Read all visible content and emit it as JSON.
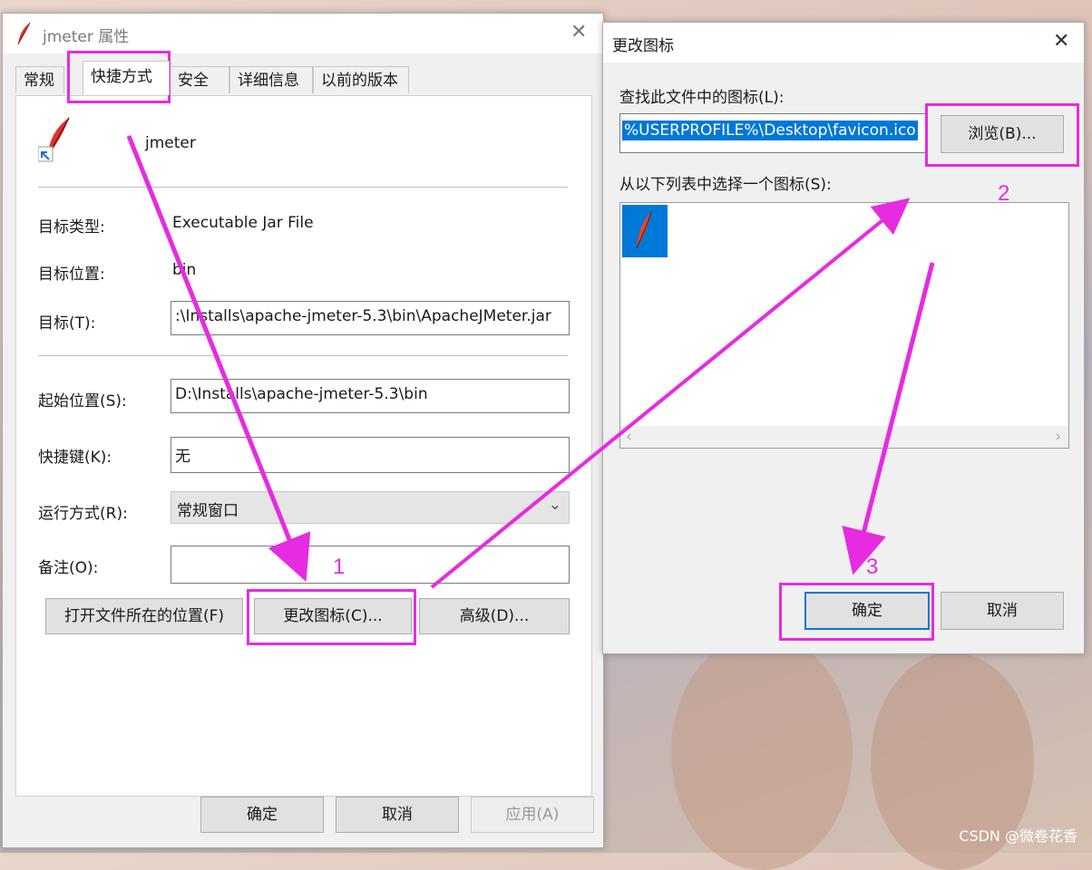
{
  "props_dialog": {
    "title": "jmeter 属性",
    "tabs": [
      {
        "label": "常规"
      },
      {
        "label": "快捷方式"
      },
      {
        "label": "安全"
      },
      {
        "label": "详细信息"
      },
      {
        "label": "以前的版本"
      }
    ],
    "shortcut_name": "jmeter",
    "fields": {
      "target_type_label": "目标类型:",
      "target_type_value": "Executable Jar File",
      "target_location_label": "目标位置:",
      "target_location_value": "bin",
      "target_label": "目标(T):",
      "target_value": ":\\Installs\\apache-jmeter-5.3\\bin\\ApacheJMeter.jar",
      "start_in_label": "起始位置(S):",
      "start_in_value": "D:\\Installs\\apache-jmeter-5.3\\bin",
      "hotkey_label": "快捷键(K):",
      "hotkey_value": "无",
      "run_label": "运行方式(R):",
      "run_value": "常规窗口",
      "comment_label": "备注(O):",
      "comment_value": ""
    },
    "buttons": {
      "open_location": "打开文件所在的位置(F)",
      "change_icon": "更改图标(C)...",
      "advanced": "高级(D)...",
      "ok": "确定",
      "cancel": "取消",
      "apply": "应用(A)"
    }
  },
  "change_icon_dialog": {
    "title": "更改图标",
    "find_label": "查找此文件中的图标(L):",
    "path_value": "%USERPROFILE%\\Desktop\\favicon.ico",
    "browse_label": "浏览(B)...",
    "list_label": "从以下列表中选择一个图标(S):",
    "ok": "确定",
    "cancel": "取消"
  },
  "annotations": {
    "step1": "1",
    "step2": "2",
    "step3": "3",
    "color": "#e62be0"
  },
  "watermark": "CSDN @微卷花香"
}
